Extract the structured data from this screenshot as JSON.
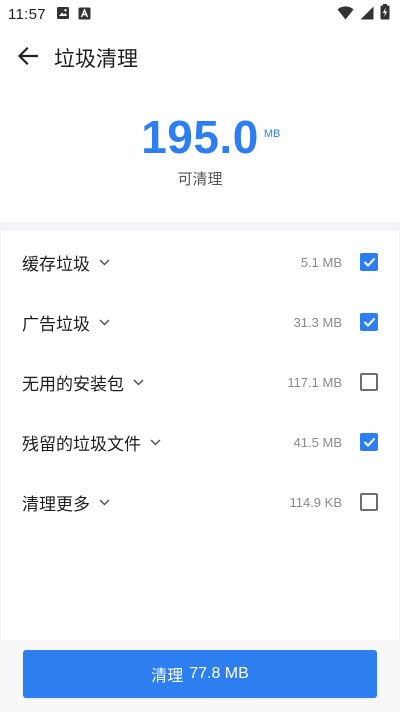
{
  "status_bar": {
    "time": "11:57",
    "left_icons": [
      "gallery-notification-icon",
      "a-notification-icon"
    ],
    "right_icons": [
      "wifi-icon",
      "signal-icon",
      "battery-charging-icon"
    ]
  },
  "app_bar": {
    "back_icon": "arrow-left-icon",
    "title": "垃圾清理"
  },
  "summary": {
    "size_value": "195.0",
    "size_unit": "MB",
    "caption": "可清理"
  },
  "items": [
    {
      "label": "缓存垃圾",
      "size": "5.1 MB",
      "checked": true
    },
    {
      "label": "广告垃圾",
      "size": "31.3 MB",
      "checked": true
    },
    {
      "label": "无用的安装包",
      "size": "117.1 MB",
      "checked": false
    },
    {
      "label": "残留的垃圾文件",
      "size": "41.5 MB",
      "checked": true
    },
    {
      "label": "清理更多",
      "size": "114.9 KB",
      "checked": false
    }
  ],
  "action": {
    "label": "清理",
    "amount": "77.8 MB"
  },
  "colors": {
    "accent": "#2d7ff0",
    "band": "#f3f5f9"
  }
}
